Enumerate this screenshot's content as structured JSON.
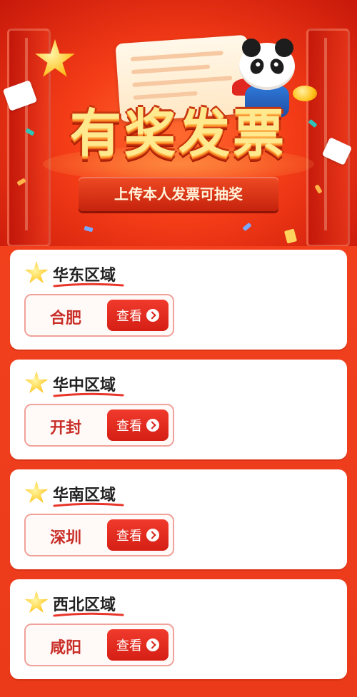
{
  "banner": {
    "title": "有奖发票",
    "subtitle": "上传本人发票可抽奖"
  },
  "regions": [
    {
      "title": "华东区域",
      "city": "合肥",
      "button": "查看"
    },
    {
      "title": "华中区域",
      "city": "开封",
      "button": "查看"
    },
    {
      "title": "华南区域",
      "city": "深圳",
      "button": "查看"
    },
    {
      "title": "西北区域",
      "city": "咸阳",
      "button": "查看"
    }
  ],
  "colors": {
    "background": "#f0401d",
    "accent": "#d51f15",
    "title_gold": "#ffe98f",
    "city_text": "#c92f28"
  },
  "icons": [
    "star-icon",
    "panda-mascot",
    "arrow-right-icon"
  ]
}
